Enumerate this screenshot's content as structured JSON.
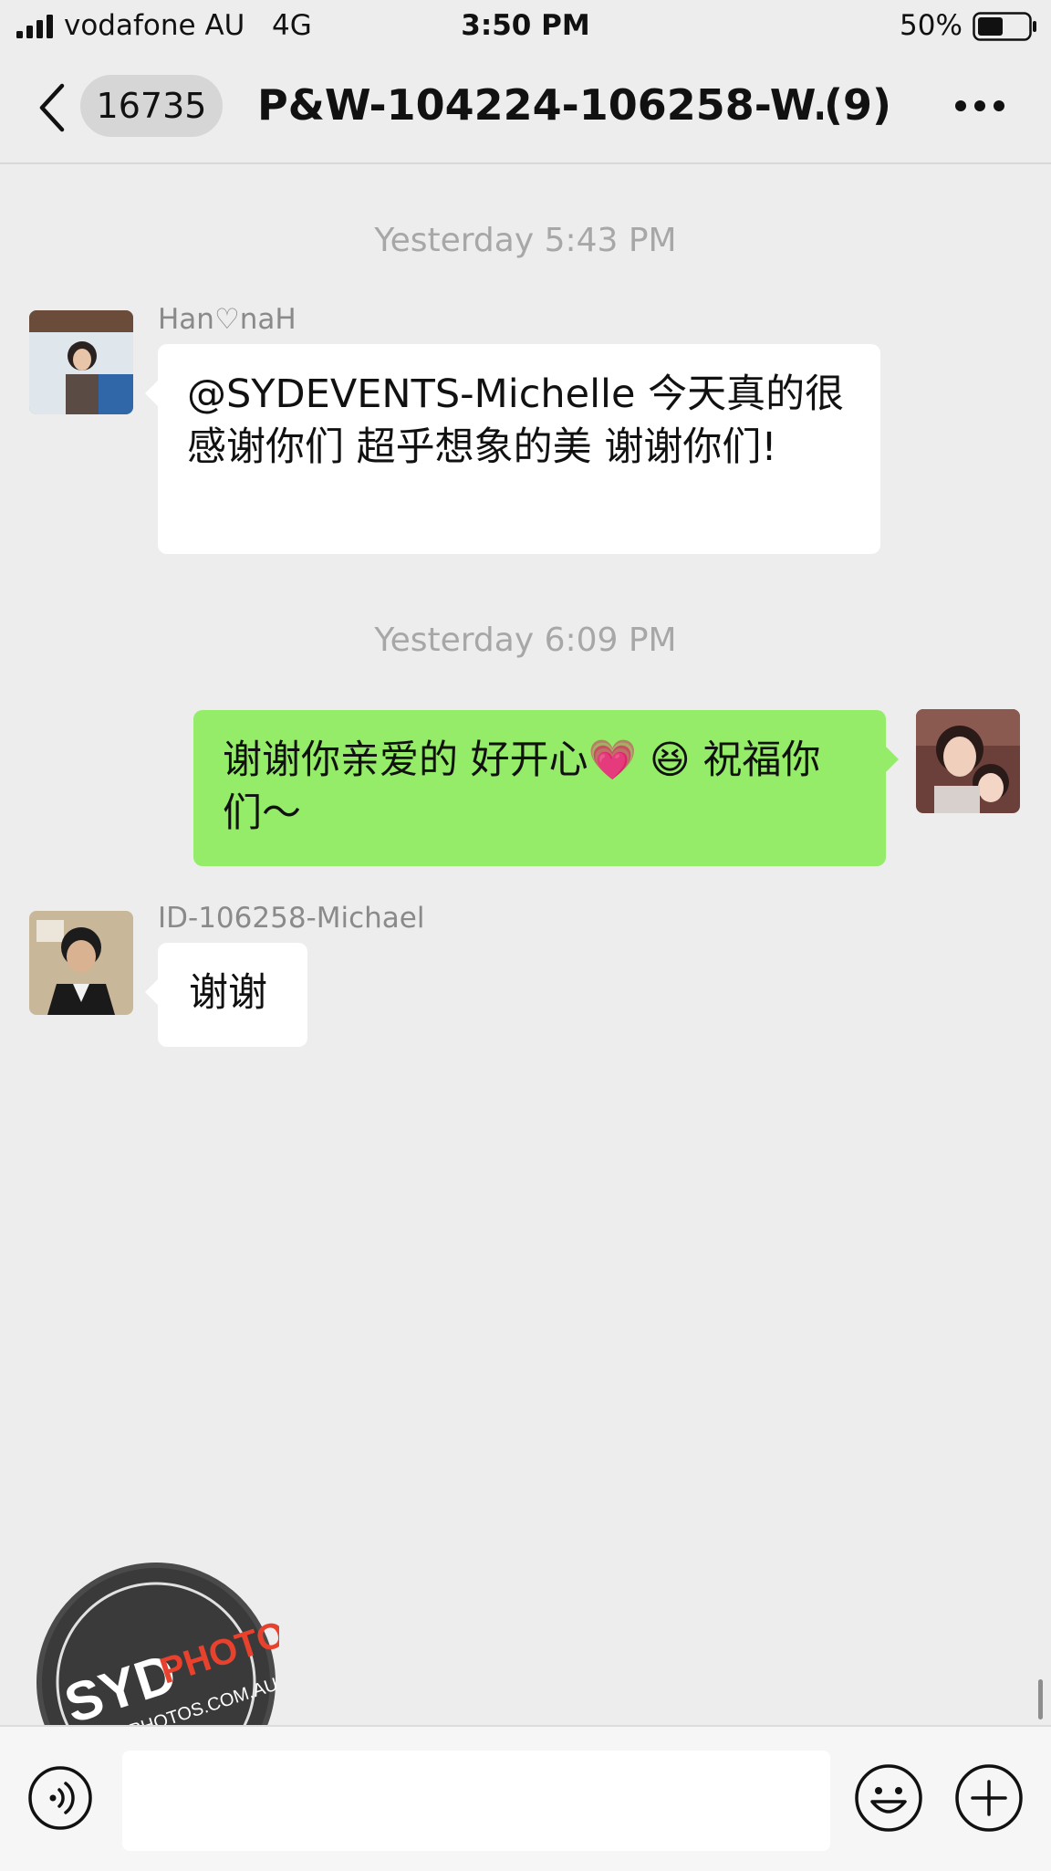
{
  "status_bar": {
    "carrier": "vodafone AU",
    "network": "4G",
    "time": "3:50 PM",
    "battery": "50%",
    "battery_level": 0.5
  },
  "nav": {
    "back_icon": "chevron-left-icon",
    "unread_count": "16735",
    "title": "P&W-104224-106258-W...",
    "member_count": "(9)",
    "more_icon": "more-dots-icon"
  },
  "messages": [
    {
      "type": "timestamp",
      "text": "Yesterday 5:43 PM"
    },
    {
      "type": "message",
      "direction": "incoming",
      "sender": "Han♡naH",
      "text": "@SYDEVENTS-Michelle  今天真的很感谢你们 超乎想象的美 谢谢你们!"
    },
    {
      "type": "timestamp",
      "text": "Yesterday 6:09 PM"
    },
    {
      "type": "message",
      "direction": "outgoing",
      "text_before": "谢谢你亲爱的 好开心",
      "emoji_1": "💗",
      "emoji_2": "😆",
      "text_after": " 祝福你们～"
    },
    {
      "type": "message",
      "direction": "incoming",
      "sender": "ID-106258-Michael",
      "text": "谢谢"
    }
  ],
  "input_bar": {
    "voice_icon": "voice-icon",
    "input_value": "",
    "emoji_icon": "smiley-icon",
    "plus_icon": "plus-icon"
  },
  "watermark": {
    "brand_left": "SYD",
    "brand_right": "PHOTOS",
    "url": "SYDPHOTOS.COM.AU"
  },
  "colors": {
    "background": "#ededed",
    "outgoing_bubble": "#95ec69",
    "incoming_bubble": "#ffffff",
    "watermark_accent": "#e8412d"
  }
}
